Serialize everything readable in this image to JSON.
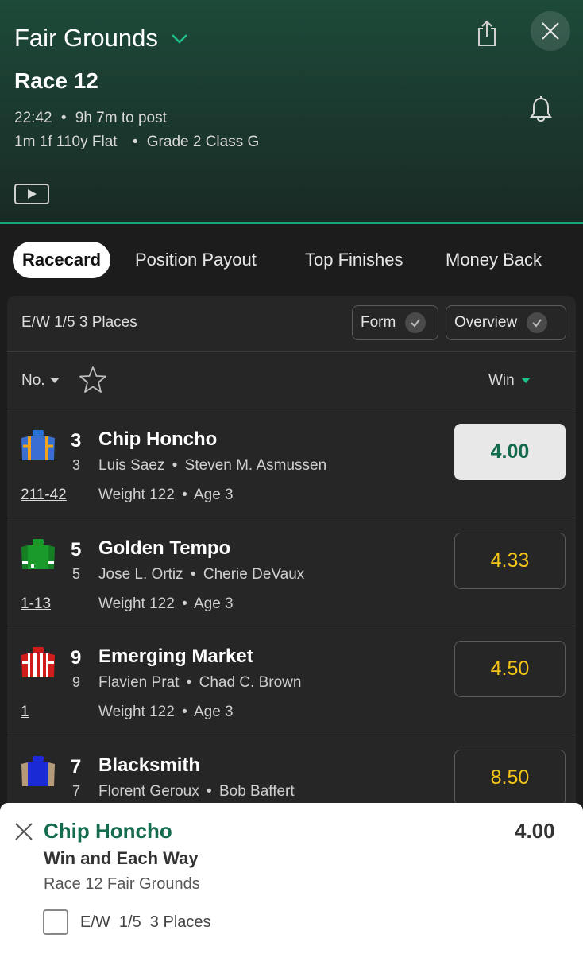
{
  "header": {
    "venue": "Fair Grounds",
    "race_title": "Race 12",
    "time": "22:42",
    "to_post": "9h 7m to post",
    "distance": "1m 1f 110y Flat",
    "grade": "Grade 2 Class G",
    "sep": "•"
  },
  "tabs": [
    "Racecard",
    "Position Payout",
    "Top Finishes",
    "Money Back"
  ],
  "card": {
    "ew_terms": "E/W 1/5 3 Places",
    "form_toggle": "Form",
    "overview_toggle": "Overview",
    "col_no": "No.",
    "col_win": "Win"
  },
  "runners": [
    {
      "no": "3",
      "draw": "3",
      "name": "Chip Honcho",
      "jockey": "Luis Saez",
      "trainer": "Steven M. Asmussen",
      "form": "211-42",
      "weight": "Weight 122",
      "age": "Age 3",
      "odds": "4.00"
    },
    {
      "no": "5",
      "draw": "5",
      "name": "Golden Tempo",
      "jockey": "Jose L. Ortiz",
      "trainer": "Cherie DeVaux",
      "form": "1-13",
      "weight": "Weight 122",
      "age": "Age 3",
      "odds": "4.33"
    },
    {
      "no": "9",
      "draw": "9",
      "name": "Emerging Market",
      "jockey": "Flavien Prat",
      "trainer": "Chad C. Brown",
      "form": "1",
      "weight": "Weight 122",
      "age": "Age 3",
      "odds": "4.50"
    },
    {
      "no": "7",
      "draw": "7",
      "name": "Blacksmith",
      "jockey": "Florent Geroux",
      "trainer": "Bob Baffert",
      "form": "",
      "weight": "",
      "age": "",
      "odds": "8.50"
    }
  ],
  "slip": {
    "selection": "Chip Honcho",
    "odds": "4.00",
    "market": "Win and Each Way",
    "event": "Race 12 Fair Grounds",
    "ew_label": "E/W  1/5  3 Places"
  },
  "colors": {
    "accent_green": "#1aa67a",
    "odds_yellow": "#f5c518",
    "selection_green": "#146b4d"
  }
}
